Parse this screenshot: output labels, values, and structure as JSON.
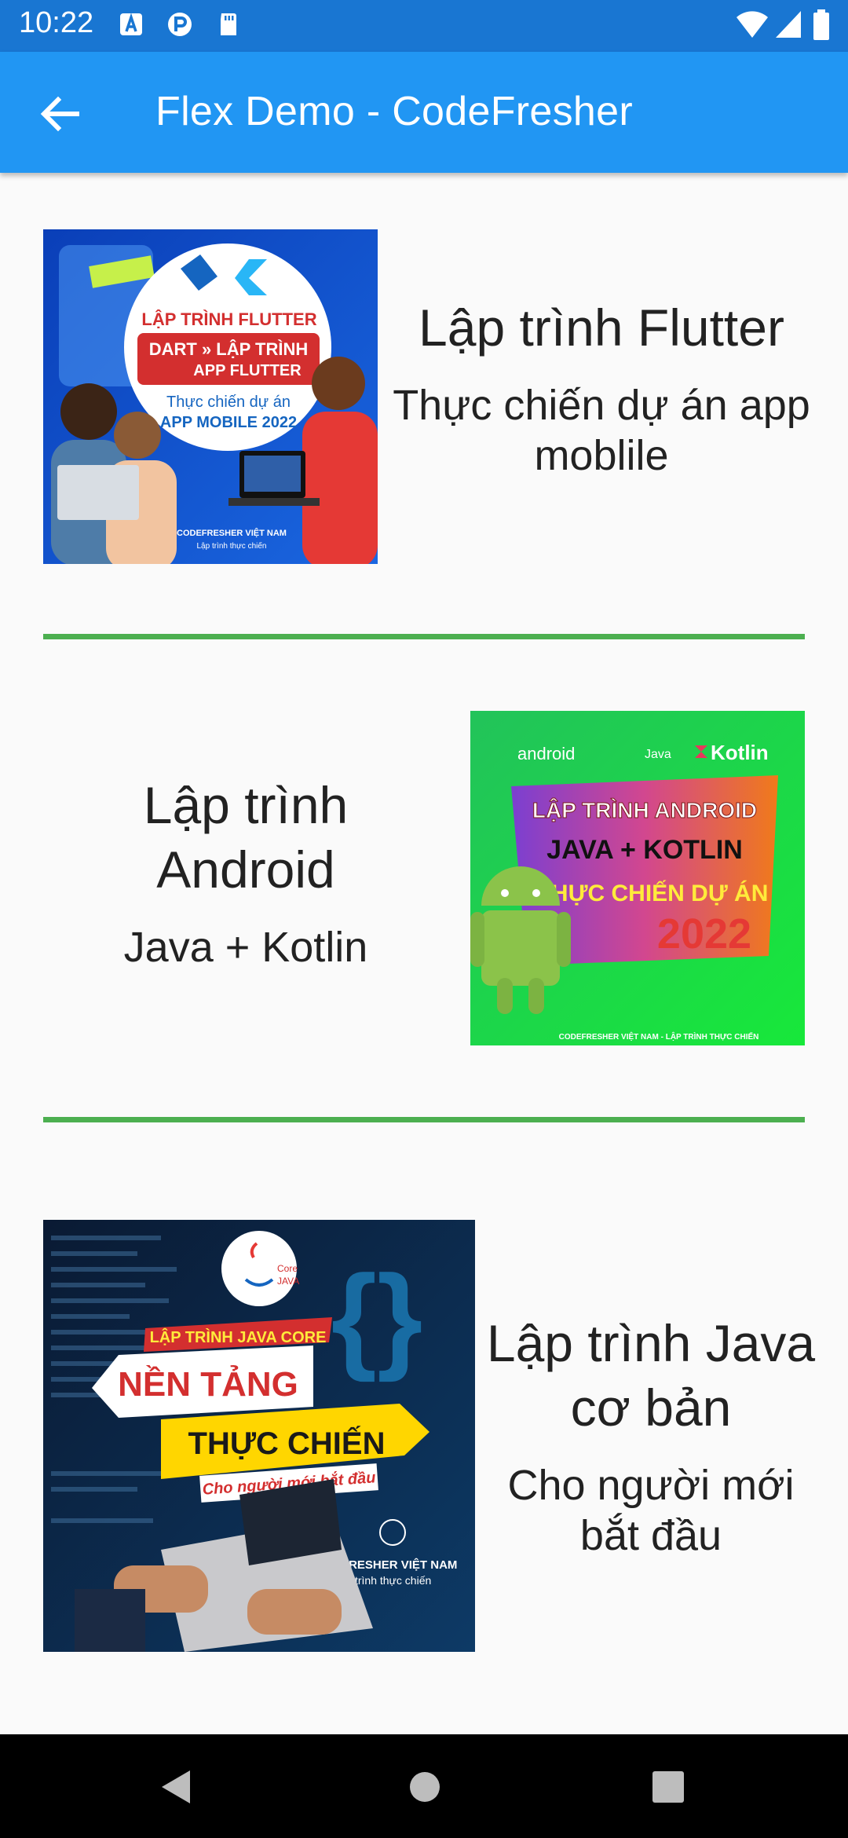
{
  "status_bar": {
    "time": "10:22"
  },
  "app_bar": {
    "title": "Flex Demo - CodeFresher"
  },
  "items": [
    {
      "title": "Lập trình Flutter",
      "subtitle": "Thực chiến dự án app moblile",
      "image": {
        "line1": "LẬP TRÌNH FLUTTER",
        "line2": "DART » LẬP TRÌNH",
        "line3": "APP FLUTTER",
        "line4": "Thực chiến dự án",
        "line5": "APP MOBILE 2022",
        "brand": "CODEFRESHER VIỆT NAM",
        "tagline": "Lập trình thực chiến"
      }
    },
    {
      "title": "Lập trình Android",
      "subtitle": "Java + Kotlin",
      "image": {
        "brand1": "android",
        "brand2": "Java",
        "brand3": "Kotlin",
        "line1": "LẬP TRÌNH ANDROID",
        "line2": "JAVA + KOTLIN",
        "line3": "THỰC CHIẾN DỰ ÁN",
        "year": "2022",
        "footer": "CODEFRESHER VIỆT NAM - LẬP TRÌNH THỰC CHIẾN"
      }
    },
    {
      "title": "Lập trình Java cơ bản",
      "subtitle": "Cho người mới bắt đầu",
      "image": {
        "badge1": "Core",
        "badge2": "JAVA",
        "line1": "LẬP TRÌNH JAVA CORE",
        "line2": "NỀN TẢNG",
        "line3": "THỰC CHIẾN",
        "line4": "Cho người mới bắt đầu",
        "brand": "CODEFRESHER VIỆT NAM",
        "tagline": "Lập trình thực chiến"
      }
    }
  ],
  "colors": {
    "status_bar": "#1976D2",
    "app_bar": "#2196F3",
    "divider": "#4CAF50",
    "background": "#FAFAFA"
  }
}
